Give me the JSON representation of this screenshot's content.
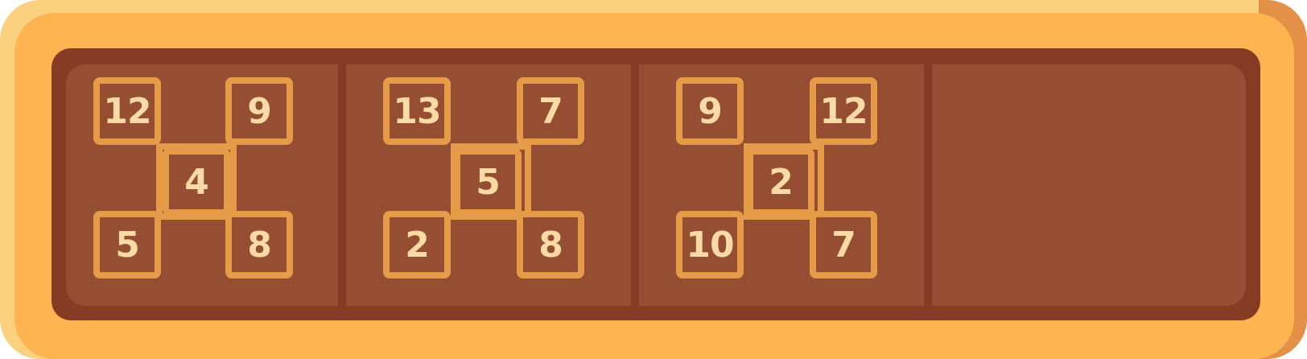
{
  "puzzles": [
    {
      "top_left": "12",
      "top_right": "9",
      "center": "4",
      "bottom_left": "5",
      "bottom_right": "8"
    },
    {
      "top_left": "13",
      "top_right": "7",
      "center": "5",
      "bottom_left": "2",
      "bottom_right": "8"
    },
    {
      "top_left": "9",
      "top_right": "12",
      "center": "2",
      "bottom_left": "10",
      "bottom_right": "7"
    }
  ],
  "colors": {
    "frame": "#feb450",
    "frame_light": "#fbd07e",
    "board_dark": "#863b23",
    "board": "#954e32",
    "cell_border": "#e59b47",
    "number": "#fbdba5"
  }
}
